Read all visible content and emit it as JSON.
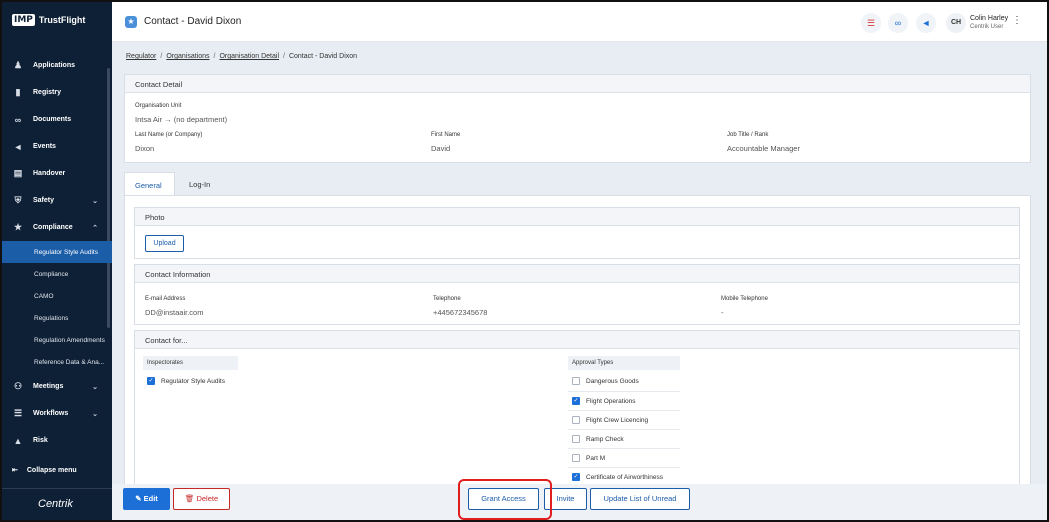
{
  "app": {
    "logo_box": "IMP",
    "logo_text": "TrustFlight",
    "brand": "Centrik"
  },
  "sidebar": {
    "items": [
      {
        "label": "Applications",
        "icon": "user-icon"
      },
      {
        "label": "Registry",
        "icon": "book-icon"
      },
      {
        "label": "Documents",
        "icon": "paperclip-icon"
      },
      {
        "label": "Events",
        "icon": "megaphone-icon"
      },
      {
        "label": "Handover",
        "icon": "tray-icon"
      },
      {
        "label": "Safety",
        "icon": "shield-icon"
      },
      {
        "label": "Compliance",
        "icon": "badge-icon"
      }
    ],
    "compliance_sub": [
      "Regulator Style Audits",
      "Compliance",
      "CAMO",
      "Regulations",
      "Regulation Amendments",
      "Reference Data & Ana..."
    ],
    "items_after": [
      {
        "label": "Meetings",
        "icon": "people-icon"
      },
      {
        "label": "Workflows",
        "icon": "workflow-icon"
      },
      {
        "label": "Risk",
        "icon": "warning-icon"
      }
    ],
    "collapse_label": "Collapse menu"
  },
  "header": {
    "title": "Contact",
    "title_sep": "-",
    "title_name": "David Dixon",
    "user_initials": "CH",
    "user_name": "Colin Harley",
    "user_role": "Centrik User"
  },
  "breadcrumb": [
    "Regulator",
    "Organisations",
    "Organisation Detail",
    "Contact - David Dixon"
  ],
  "contact_detail": {
    "heading": "Contact Detail",
    "org_unit_label": "Organisation Unit",
    "org_unit_value": "Intsa Air → (no department)",
    "last_name_label": "Last Name (or Company)",
    "last_name_value": "Dixon",
    "first_name_label": "First Name",
    "first_name_value": "David",
    "job_title_label": "Job Title / Rank",
    "job_title_value": "Accountable Manager"
  },
  "tabs": [
    "General",
    "Log-In"
  ],
  "photo": {
    "heading": "Photo",
    "upload_label": "Upload"
  },
  "contact_info": {
    "heading": "Contact Information",
    "email_label": "E-mail Address",
    "email_value": "DD@instaair.com",
    "phone_label": "Telephone",
    "phone_value": "+445672345678",
    "mobile_label": "Mobile Telephone",
    "mobile_value": "-"
  },
  "contact_for": {
    "heading": "Contact for...",
    "inspectorates_label": "Inspectorates",
    "inspectorates": [
      {
        "label": "Regulator Style Audits",
        "checked": true
      }
    ],
    "approval_label": "Approval Types",
    "approvals": [
      {
        "label": "Dangerous Goods",
        "checked": false
      },
      {
        "label": "Flight Operations",
        "checked": true
      },
      {
        "label": "Flight Crew Licencing",
        "checked": false
      },
      {
        "label": "Ramp Check",
        "checked": false
      },
      {
        "label": "Part M",
        "checked": false
      },
      {
        "label": "Certificate of Airworthiness",
        "checked": true
      }
    ]
  },
  "footer": {
    "edit": "Edit",
    "delete": "Delete",
    "grant": "Grant Access",
    "invite": "Invite",
    "update": "Update List of Unread"
  },
  "colors": {
    "sidebar_bg": "#0e2036",
    "accent": "#1c6fd6",
    "danger": "#c62828",
    "highlight": "#e01e1e"
  }
}
